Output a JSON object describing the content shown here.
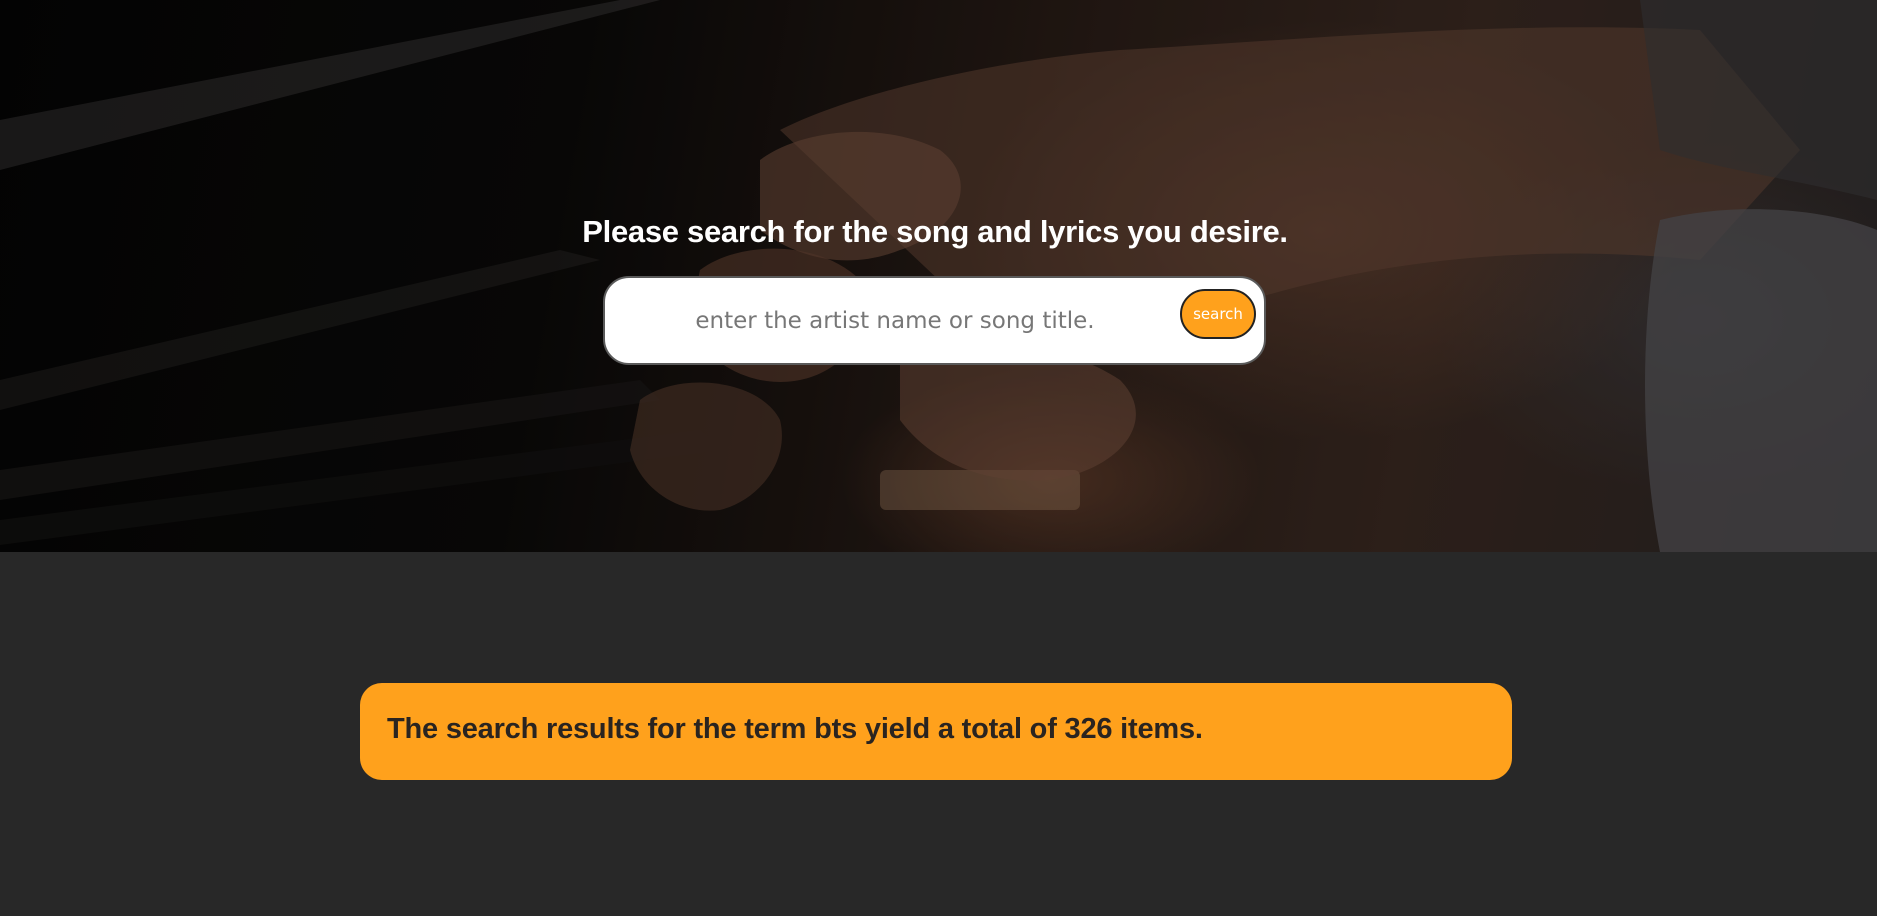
{
  "hero": {
    "heading": "Please search for the song and lyrics you desire.",
    "background_image": "hands-playing-piano-photo"
  },
  "search": {
    "placeholder": "enter the artist name or song title.",
    "value": "",
    "button_label": "search"
  },
  "results": {
    "summary": "The search results for the term bts yield a total of 326 items."
  },
  "colors": {
    "accent": "#ffa11c",
    "page_background": "#282828",
    "banner_text": "#2a2420",
    "heading_text": "#ffffff"
  }
}
